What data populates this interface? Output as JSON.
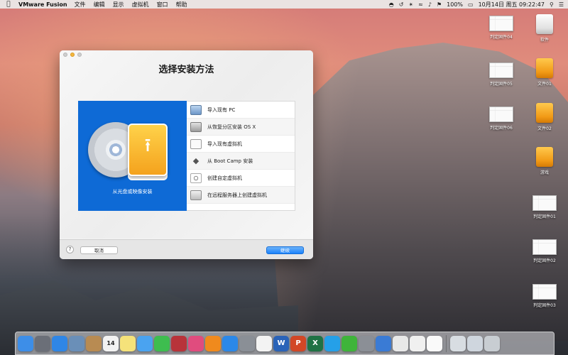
{
  "menubar": {
    "app_name": "VMware Fusion",
    "menus": [
      "文件",
      "编辑",
      "显示",
      "虚拟机",
      "窗口",
      "帮助"
    ],
    "battery": "100%",
    "clock": "10月14日 周五  09:22:47"
  },
  "dialog": {
    "title": "选择安装方法",
    "hero_label": "从光盘或映像安装",
    "options": [
      {
        "label": "导入现有 PC",
        "icon": "monitor-icon"
      },
      {
        "label": "从恢复分区安装 OS X",
        "icon": "hard-drive-icon"
      },
      {
        "label": "导入现有虚拟机",
        "icon": "document-icon"
      },
      {
        "label": "从 Boot Camp 安装",
        "icon": "bootcamp-icon"
      },
      {
        "label": "创建自定虚拟机",
        "icon": "disc-icon"
      },
      {
        "label": "在远程服务器上创建虚拟机",
        "icon": "server-icon"
      }
    ],
    "help_label": "?",
    "cancel_label": "取消",
    "continue_label": "继续"
  },
  "desktop": {
    "icons": [
      {
        "label": "判定固件04",
        "type": "thumb"
      },
      {
        "label": "软件",
        "type": "drive-white"
      },
      {
        "label": "判定固件05",
        "type": "thumb"
      },
      {
        "label": "文件01",
        "type": "drive-orange"
      },
      {
        "label": "判定固件06",
        "type": "thumb"
      },
      {
        "label": "文件02",
        "type": "drive-orange"
      },
      {
        "label": "游戏",
        "type": "drive-orange"
      },
      {
        "label": "判定固件01",
        "type": "thumb"
      },
      {
        "label": "判定固件02",
        "type": "thumb"
      },
      {
        "label": "判定固件03",
        "type": "thumb"
      }
    ]
  },
  "dock": {
    "items": [
      {
        "name": "finder",
        "color": "#3d8ee8"
      },
      {
        "name": "launchpad",
        "color": "#6b6f78"
      },
      {
        "name": "safari",
        "color": "#2f86e6"
      },
      {
        "name": "preview",
        "color": "#6a8fb8"
      },
      {
        "name": "contacts",
        "color": "#b88b52"
      },
      {
        "name": "calendar",
        "color": "#f2f2f2",
        "text": "14"
      },
      {
        "name": "notes",
        "color": "#f5e27a"
      },
      {
        "name": "messages",
        "color": "#4aa3f0"
      },
      {
        "name": "facetime",
        "color": "#3ebd4f"
      },
      {
        "name": "photo-booth",
        "color": "#b8333a"
      },
      {
        "name": "itunes",
        "color": "#e04c7e"
      },
      {
        "name": "ibooks",
        "color": "#f08a1d"
      },
      {
        "name": "app-store",
        "color": "#2b88e8"
      },
      {
        "name": "system-preferences",
        "color": "#8a8f96"
      },
      {
        "name": "photos",
        "color": "#f3f3f3"
      },
      {
        "name": "word",
        "color": "#2a63b8",
        "text": "W"
      },
      {
        "name": "powerpoint",
        "color": "#d24726",
        "text": "P"
      },
      {
        "name": "excel",
        "color": "#1f7244",
        "text": "X"
      },
      {
        "name": "qq",
        "color": "#25a0e8"
      },
      {
        "name": "wechat",
        "color": "#3fb43a"
      },
      {
        "name": "vmware-fusion",
        "color": "#8b8f96"
      },
      {
        "name": "network-utility",
        "color": "#3a7bd5"
      },
      {
        "name": "script-editor",
        "color": "#e8e8e8"
      },
      {
        "name": "texteditor",
        "color": "#f0f0f0"
      },
      {
        "name": "document",
        "color": "#fafafa"
      },
      {
        "name": "screenshot",
        "color": "#d8dde2"
      },
      {
        "name": "downloads",
        "color": "#cfd6de"
      },
      {
        "name": "trash",
        "color": "#c8cdd2"
      }
    ]
  }
}
